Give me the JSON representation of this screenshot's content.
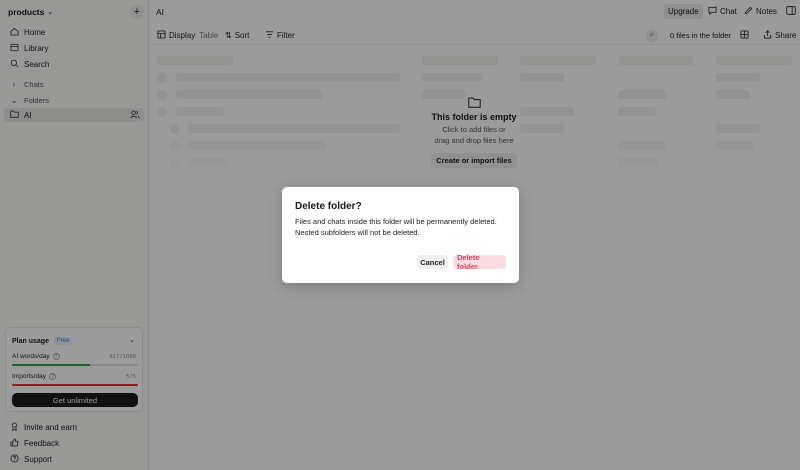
{
  "sidebar": {
    "workspace": "products",
    "nav": [
      {
        "label": "Home",
        "icon": "home-icon"
      },
      {
        "label": "Library",
        "icon": "library-icon"
      },
      {
        "label": "Search",
        "icon": "search-icon"
      }
    ],
    "chats_label": "Chats",
    "folders_label": "Folders",
    "folder_item": "AI",
    "plan": {
      "title": "Plan usage",
      "badge": "Free",
      "words_label": "AI words/day",
      "words_value": "617/1000",
      "words_fraction": 0.617,
      "imports_label": "Imports/day",
      "imports_value": "5/5",
      "imports_fraction": 1.0,
      "cta": "Get unlimited"
    },
    "footer": [
      {
        "label": "Invite and earn",
        "icon": "gift-icon"
      },
      {
        "label": "Feedback",
        "icon": "thumbs-up-icon"
      },
      {
        "label": "Support",
        "icon": "help-icon"
      }
    ]
  },
  "topbar": {
    "breadcrumb": "AI",
    "upgrade": "Upgrade",
    "chat": "Chat",
    "notes": "Notes"
  },
  "toolbar": {
    "display": "Display",
    "display_value": "Table",
    "sort": "Sort",
    "filter": "Filter",
    "avatar_initial": "P",
    "file_count": "0 files in the folder",
    "share": "Share"
  },
  "empty_state": {
    "title": "This folder is empty",
    "line1": "Click to add files or",
    "line2": "drag and drop files here",
    "button": "Create or import files"
  },
  "modal": {
    "title": "Delete folder?",
    "line1": "Files and chats inside this folder will be permanently deleted.",
    "line2": "Nested subfolders will not be deleted.",
    "cancel": "Cancel",
    "confirm": "Delete folder"
  },
  "colors": {
    "progress_ok": "#2ea44f",
    "progress_full": "#d93636",
    "danger_text": "#d9405f",
    "danger_bg": "#f8dde3",
    "badge_blue": "#4a6fc4"
  }
}
